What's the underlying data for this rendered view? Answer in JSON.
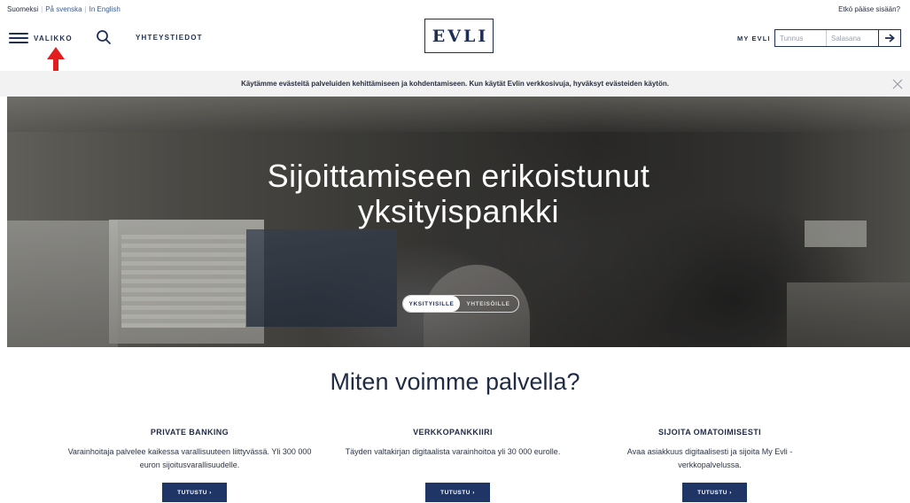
{
  "header": {
    "languages": [
      "Suomeksi",
      "På svenska",
      "In English"
    ],
    "forgot_link": "Etkö pääse sisään?",
    "menu_label": "VALIKKO",
    "contact_label": "YHTEYSTIEDOT",
    "logo_text": "EVLI",
    "myevli_label": "MY EVLI",
    "username_placeholder": "Tunnus",
    "password_placeholder": "Salasana"
  },
  "cookie_bar": {
    "text": "Käytämme evästeitä palveluiden kehittämiseen ja kohdentamiseen. Kun käytät Evlin verkkosivuja, hyväksyt evästeiden käytön."
  },
  "hero": {
    "title_line1": "Sijoittamiseen erikoistunut",
    "title_line2": "yksityispankki",
    "segments": [
      "YKSITYISILLE",
      "YHTEISÖILLE"
    ],
    "active_segment": "YKSITYISILLE"
  },
  "services": {
    "title": "Miten voimme palvella?",
    "items": [
      {
        "heading": "PRIVATE BANKING",
        "text": "Varainhoitaja palvelee kaikessa varallisuuteen liittyvässä. Yli 300 000 euron sijoitusvarallisuudelle.",
        "button": "TUTUSTU ›"
      },
      {
        "heading": "VERKKOPANKKIIRI",
        "text": "Täyden valtakirjan digitaalista varainhoitoa yli 30 000 eurolle.",
        "button": "TUTUSTU ›"
      },
      {
        "heading": "SIJOITA OMATOIMISESTI",
        "text": "Avaa asiakkuus digitaalisesti ja sijoita My Evli -verkkopalvelussa.",
        "button": "TUTUSTU ›"
      }
    ]
  },
  "colors": {
    "brand_navy": "#1f3566",
    "text_dark": "#1f2a44",
    "annotation_red": "#e31e1e",
    "cookie_bg": "#f2f2f2"
  },
  "icons": [
    "hamburger-icon",
    "search-icon",
    "arrow-right-icon",
    "close-icon",
    "red-arrow-annotation"
  ]
}
